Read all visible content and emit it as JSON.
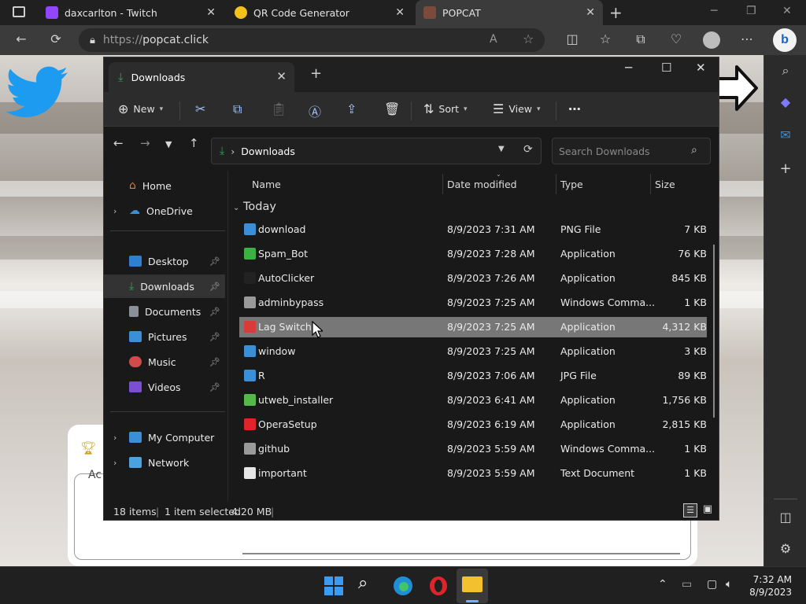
{
  "browser": {
    "tabs": [
      {
        "title": "daxcarlton - Twitch",
        "color": "#9146ff"
      },
      {
        "title": "QR Code Generator",
        "color": "#f4c01c"
      },
      {
        "title": "POPCAT",
        "color": "#7a4b3a"
      }
    ],
    "url_prefix": "https://",
    "url_host": "popcat.click"
  },
  "explorer": {
    "tab_title": "Downloads",
    "toolbar": {
      "new": "New",
      "sort": "Sort",
      "view": "View"
    },
    "path": "Downloads",
    "search_placeholder": "Search Downloads",
    "nav": {
      "home": "Home",
      "onedrive": "OneDrive",
      "quick": [
        {
          "label": "Desktop",
          "color": "#2f7fd1"
        },
        {
          "label": "Downloads",
          "color": "#2ea44f"
        },
        {
          "label": "Documents",
          "color": "#8a8f98"
        },
        {
          "label": "Pictures",
          "color": "#3a8fd6"
        },
        {
          "label": "Music",
          "color": "#d24b4b"
        },
        {
          "label": "Videos",
          "color": "#7b4fd1"
        }
      ],
      "this_pc": "My Computer",
      "network": "Network"
    },
    "columns": {
      "name": "Name",
      "date": "Date modified",
      "type": "Type",
      "size": "Size"
    },
    "group": "Today",
    "files": [
      {
        "name": "download",
        "date": "8/9/2023 7:31 AM",
        "type": "PNG File",
        "size": "7 KB",
        "icon": "#3a8fd6"
      },
      {
        "name": "Spam_Bot",
        "date": "8/9/2023 7:28 AM",
        "type": "Application",
        "size": "76 KB",
        "icon": "#3cb043"
      },
      {
        "name": "AutoClicker",
        "date": "8/9/2023 7:26 AM",
        "type": "Application",
        "size": "845 KB",
        "icon": "#222222"
      },
      {
        "name": "adminbypass",
        "date": "8/9/2023 7:25 AM",
        "type": "Windows Comma...",
        "size": "1 KB",
        "icon": "#9a9a9a"
      },
      {
        "name": "Lag Switch",
        "date": "8/9/2023 7:25 AM",
        "type": "Application",
        "size": "4,312 KB",
        "icon": "#d93a3a"
      },
      {
        "name": "window",
        "date": "8/9/2023 7:25 AM",
        "type": "Application",
        "size": "3 KB",
        "icon": "#3a8fd6"
      },
      {
        "name": "R",
        "date": "8/9/2023 7:06 AM",
        "type": "JPG File",
        "size": "89 KB",
        "icon": "#3a8fd6"
      },
      {
        "name": "utweb_installer",
        "date": "8/9/2023 6:41 AM",
        "type": "Application",
        "size": "1,756 KB",
        "icon": "#54b948"
      },
      {
        "name": "OperaSetup",
        "date": "8/9/2023 6:19 AM",
        "type": "Application",
        "size": "2,815 KB",
        "icon": "#e0242b"
      },
      {
        "name": "github",
        "date": "8/9/2023 5:59 AM",
        "type": "Windows Comma...",
        "size": "1 KB",
        "icon": "#9a9a9a"
      },
      {
        "name": "important",
        "date": "8/9/2023 5:59 AM",
        "type": "Text Document",
        "size": "1 KB",
        "icon": "#e6e6e6"
      }
    ],
    "selected_index": 4,
    "status": {
      "count": "18 items",
      "selected": "1 item selected",
      "size": "4.20 MB"
    }
  },
  "page": {
    "card_text": "Ac"
  },
  "taskbar": {
    "time": "7:32 AM",
    "date": "8/9/2023"
  },
  "colors": {
    "accent": "#0078d4",
    "selection": "#777777"
  }
}
